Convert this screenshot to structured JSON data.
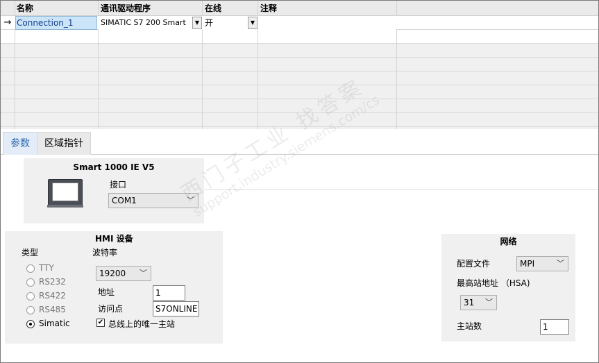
{
  "grid": {
    "headers": [
      "名称",
      "通讯驱动程序",
      "在线",
      "注释"
    ],
    "row_marker": "→",
    "connection": {
      "name": "Connection_1",
      "driver": "SIMATIC S7 200 Smart",
      "online": "开",
      "comment": ""
    }
  },
  "tabs": {
    "params": "参数",
    "area_pointer": "区域指针"
  },
  "device": {
    "title": "Smart 1000 IE V5",
    "interface_label": "接口",
    "interface_value": "COM1"
  },
  "hmi": {
    "title": "HMI 设备",
    "type_label": "类型",
    "types": [
      "TTY",
      "RS232",
      "RS422",
      "RS485",
      "Simatic"
    ],
    "selected_type": "Simatic",
    "baud_label": "波特率",
    "baud_value": "19200",
    "address_label": "地址",
    "address_value": "1",
    "access_point_label": "访问点",
    "access_point_value": "S7ONLINE",
    "only_master_label": "总线上的唯一主站",
    "only_master_checked": true,
    "check_glyph": "✔"
  },
  "network": {
    "title": "网络",
    "profile_label": "配置文件",
    "profile_value": "MPI",
    "hsa_label": "最高站地址 （HSA)",
    "hsa_value": "31",
    "masters_label": "主站数",
    "masters_value": "1"
  },
  "watermark": {
    "line1": "西门子工业 找答案",
    "line2": "support.industry.siemens.com/cs"
  }
}
